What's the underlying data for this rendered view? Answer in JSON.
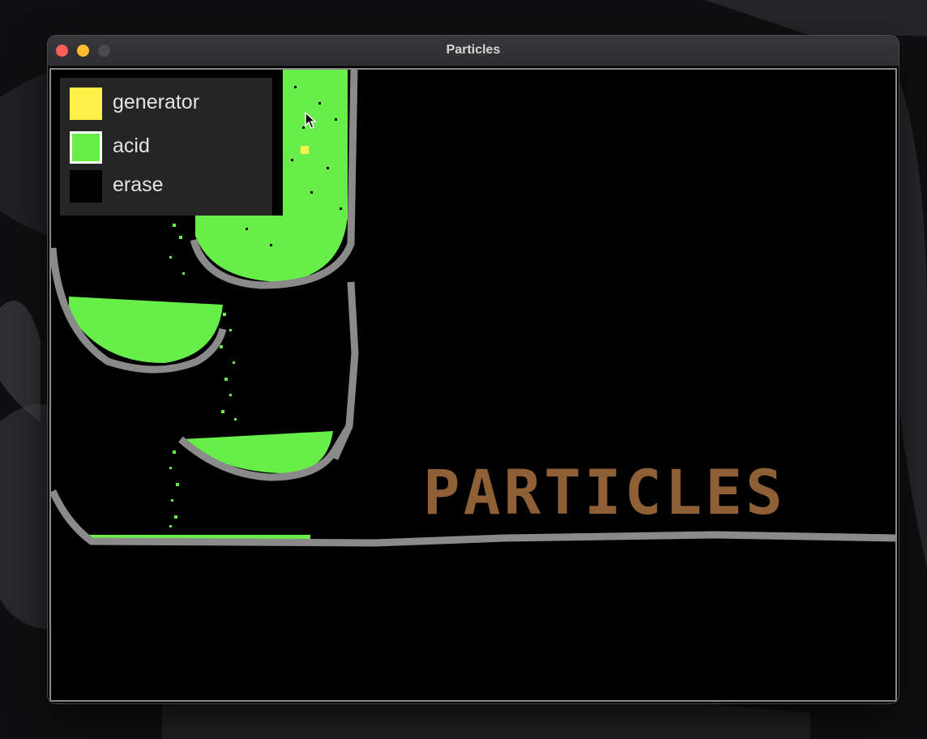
{
  "window": {
    "title": "Particles",
    "buttons": {
      "close": "#ff5f57",
      "minimize": "#febc2e",
      "maximize": "#4b4b4e"
    }
  },
  "palette": {
    "tools": [
      {
        "label": "generator",
        "color": "#fff04a",
        "selected": false
      },
      {
        "label": "acid",
        "color": "#67ee48",
        "selected": true
      },
      {
        "label": "erase",
        "color": "#000000",
        "selected": false
      }
    ]
  },
  "canvas": {
    "wordmark": "PARTICLES",
    "colors": {
      "wall": "#8a8a8a",
      "acid": "#67ee48",
      "generator": "#fff04a",
      "wordmark": "#8f6035"
    }
  }
}
